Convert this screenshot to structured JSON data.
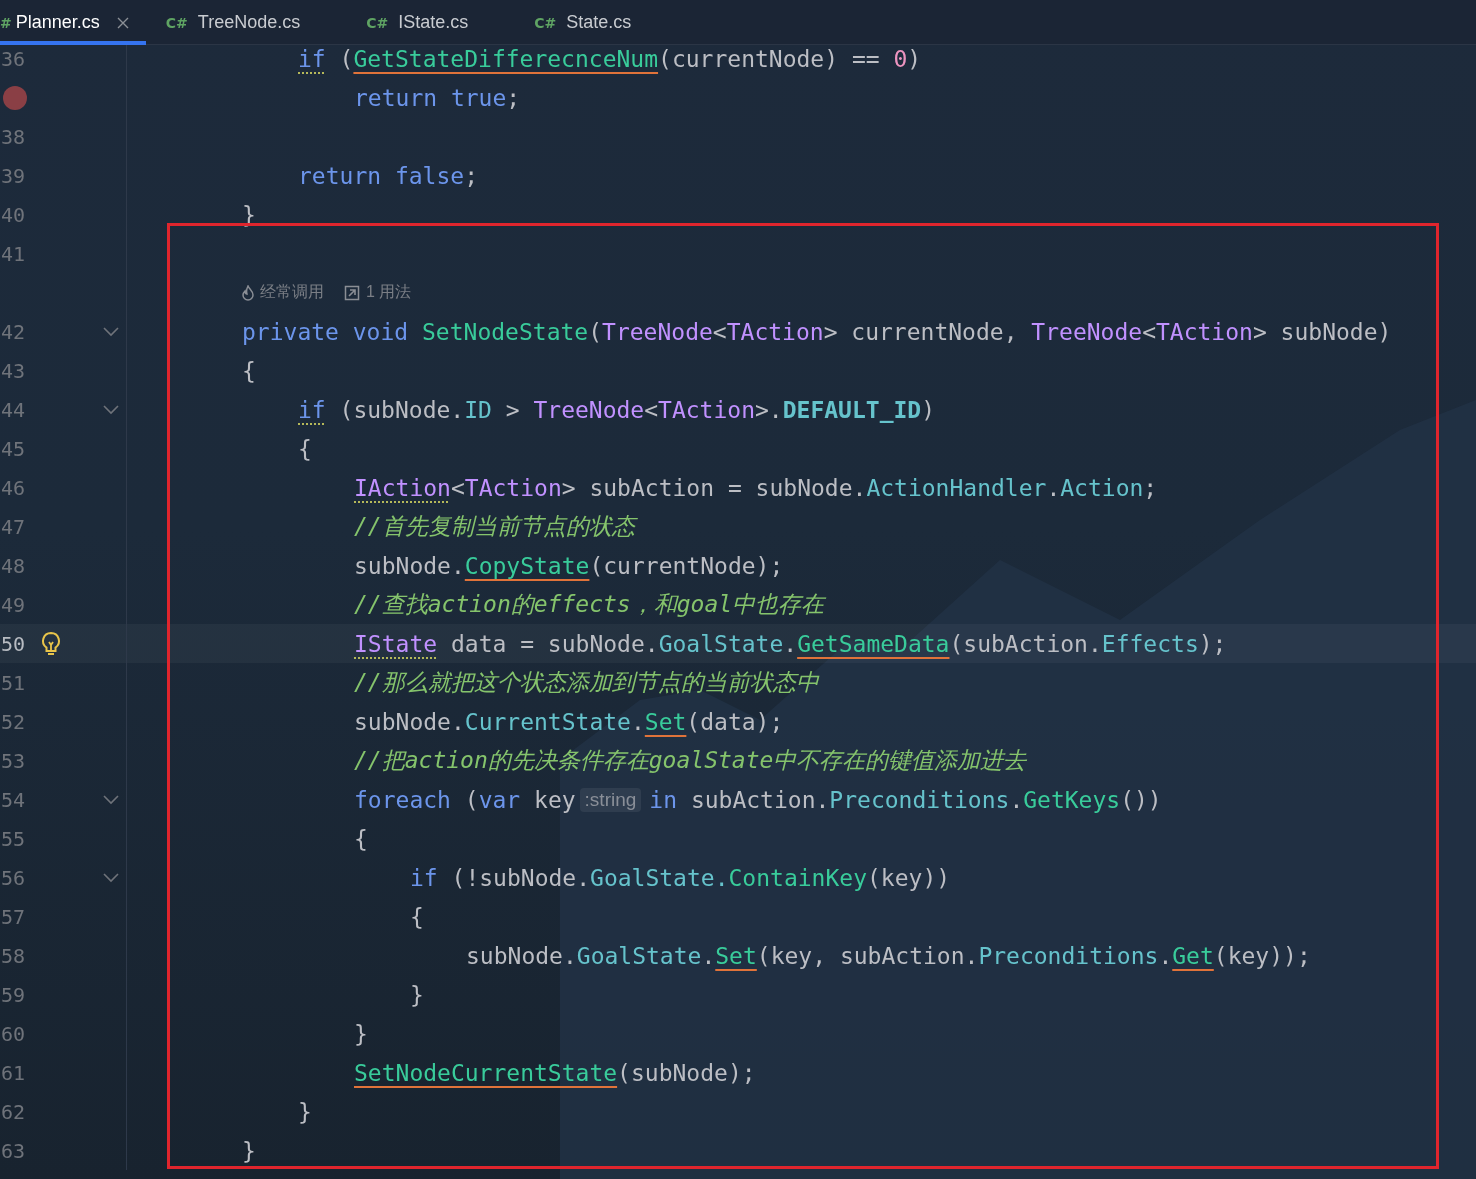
{
  "tabs": [
    {
      "icon": "#",
      "label": "Planner.cs",
      "selected": true
    },
    {
      "icon": "C#",
      "label": "TreeNode.cs",
      "selected": false
    },
    {
      "icon": "C#",
      "label": "IState.cs",
      "selected": false
    },
    {
      "icon": "C#",
      "label": "State.cs",
      "selected": false
    }
  ],
  "lines": [
    {
      "kind": "block",
      "children": [
        {
          "kind": "code",
          "number": "36",
          "tokens": [
            {
              "text": "if",
              "kind": "keyword",
              "warning": true
            },
            {
              "text": " (",
              "kind": "plain"
            },
            {
              "text": "GetStateDifferecnceNum",
              "kind": "method",
              "error": true
            },
            {
              "text": "(currentNode) == ",
              "kind": "plain"
            },
            {
              "text": "0",
              "kind": "number"
            },
            {
              "text": ")",
              "kind": "plain"
            }
          ],
          "children": [
            {
              "kind": "code",
              "breakpoint": true,
              "tokens": [
                {
                  "text": "return true",
                  "kind": "keyword"
                },
                {
                  "text": ";",
                  "kind": "plain"
                }
              ]
            }
          ]
        },
        {
          "kind": "code",
          "number": "38"
        },
        {
          "kind": "code",
          "number": "39",
          "tokens": [
            {
              "text": "return false",
              "kind": "keyword"
            },
            {
              "text": ";",
              "kind": "plain"
            }
          ]
        }
      ]
    },
    {
      "kind": "code",
      "number": "40",
      "tokens": [
        {
          "text": "}",
          "kind": "plain"
        }
      ]
    },
    {
      "kind": "code",
      "number": "41"
    },
    {
      "kind": "hint",
      "usage": "经常调用",
      "refs": "1 用法"
    },
    {
      "kind": "code",
      "number": "42",
      "fold": true,
      "tokens": [
        {
          "text": "private void ",
          "kind": "keyword"
        },
        {
          "text": "SetNodeState",
          "kind": "method"
        },
        {
          "text": "(",
          "kind": "plain"
        },
        {
          "text": "TreeNode",
          "kind": "type"
        },
        {
          "text": "<",
          "kind": "plain"
        },
        {
          "text": "TAction",
          "kind": "type"
        },
        {
          "text": "> currentNode, ",
          "kind": "plain"
        },
        {
          "text": "TreeNode",
          "kind": "type"
        },
        {
          "text": "<",
          "kind": "plain"
        },
        {
          "text": "TAction",
          "kind": "type"
        },
        {
          "text": "> subNode)",
          "kind": "plain"
        }
      ]
    },
    {
      "kind": "code",
      "number": "43",
      "tokens": [
        {
          "text": "{",
          "kind": "plain"
        }
      ],
      "children": [
        {
          "kind": "code",
          "number": "44",
          "fold": true,
          "tokens": [
            {
              "text": "if",
              "kind": "keyword",
              "warning": true
            },
            {
              "text": " (subNode.",
              "kind": "plain"
            },
            {
              "text": "ID",
              "kind": "property"
            },
            {
              "text": " > ",
              "kind": "plain"
            },
            {
              "text": "TreeNode",
              "kind": "type"
            },
            {
              "text": "<",
              "kind": "plain"
            },
            {
              "text": "TAction",
              "kind": "type"
            },
            {
              "text": ">.",
              "kind": "plain"
            },
            {
              "text": "DEFAULT_ID",
              "kind": "constant"
            },
            {
              "text": ")",
              "kind": "plain"
            }
          ]
        },
        {
          "kind": "code",
          "number": "45",
          "tokens": [
            {
              "text": "{",
              "kind": "plain"
            }
          ],
          "children": [
            {
              "kind": "code",
              "number": "46",
              "tokens": [
                {
                  "text": "IAction",
                  "kind": "type",
                  "warning": true
                },
                {
                  "text": "<",
                  "kind": "plain"
                },
                {
                  "text": "TAction",
                  "kind": "type"
                },
                {
                  "text": "> subAction = subNode.",
                  "kind": "plain"
                },
                {
                  "text": "ActionHandler",
                  "kind": "property"
                },
                {
                  "text": ".",
                  "kind": "plain"
                },
                {
                  "text": "Action",
                  "kind": "property"
                },
                {
                  "text": ";",
                  "kind": "plain"
                }
              ]
            },
            {
              "kind": "code",
              "number": "47",
              "tokens": [
                {
                  "text": "//首先复制当前节点的状态",
                  "kind": "comment"
                }
              ]
            },
            {
              "kind": "code",
              "number": "48",
              "tokens": [
                {
                  "text": "subNode.",
                  "kind": "plain"
                },
                {
                  "text": "CopyState",
                  "kind": "method",
                  "error": true
                },
                {
                  "text": "(currentNode);",
                  "kind": "plain"
                }
              ]
            },
            {
              "kind": "code",
              "number": "49",
              "tokens": [
                {
                  "text": "//查找action的effects，和goal中也存在",
                  "kind": "comment"
                }
              ]
            },
            {
              "kind": "code",
              "number": "50",
              "current": true,
              "bulb": true,
              "tokens": [
                {
                  "text": "IState",
                  "kind": "type",
                  "warning": true
                },
                {
                  "text": " data = subNode.",
                  "kind": "plain"
                },
                {
                  "text": "GoalState",
                  "kind": "property"
                },
                {
                  "text": ".",
                  "kind": "plain"
                },
                {
                  "text": "GetSameData",
                  "kind": "method",
                  "error": true
                },
                {
                  "text": "(subAction.",
                  "kind": "plain"
                },
                {
                  "text": "Effects",
                  "kind": "property"
                },
                {
                  "text": ");",
                  "kind": "plain"
                }
              ]
            },
            {
              "kind": "code",
              "number": "51",
              "tokens": [
                {
                  "text": "//那么就把这个状态添加到节点的当前状态中",
                  "kind": "comment"
                }
              ]
            },
            {
              "kind": "code",
              "number": "52",
              "tokens": [
                {
                  "text": "subNode.",
                  "kind": "plain"
                },
                {
                  "text": "CurrentState",
                  "kind": "property"
                },
                {
                  "text": ".",
                  "kind": "plain"
                },
                {
                  "text": "Set",
                  "kind": "method",
                  "error": true
                },
                {
                  "text": "(data);",
                  "kind": "plain"
                }
              ]
            },
            {
              "kind": "code",
              "number": "53",
              "tokens": [
                {
                  "text": "//把action的先决条件存在goalState中不存在的键值添加进去",
                  "kind": "comment"
                }
              ]
            },
            {
              "kind": "code",
              "number": "54",
              "fold": true,
              "tokens": [
                {
                  "text": "foreach",
                  "kind": "keyword"
                },
                {
                  "text": " (",
                  "kind": "plain"
                },
                {
                  "text": "var",
                  "kind": "keyword"
                },
                {
                  "text": " key",
                  "kind": "plain"
                },
                {
                  "text": ":string",
                  "kind": "inlay"
                },
                {
                  "text": "in",
                  "kind": "keyword"
                },
                {
                  "text": " subAction.",
                  "kind": "plain"
                },
                {
                  "text": "Preconditions",
                  "kind": "property"
                },
                {
                  "text": ".",
                  "kind": "plain"
                },
                {
                  "text": "GetKeys",
                  "kind": "method"
                },
                {
                  "text": "())",
                  "kind": "plain"
                }
              ]
            },
            {
              "kind": "code",
              "number": "55",
              "tokens": [
                {
                  "text": "{",
                  "kind": "plain"
                }
              ],
              "children": [
                {
                  "kind": "code",
                  "number": "56",
                  "fold": true,
                  "tokens": [
                    {
                      "text": "if",
                      "kind": "keyword"
                    },
                    {
                      "text": " (!subNode.",
                      "kind": "plain"
                    },
                    {
                      "text": "GoalState.",
                      "kind": "property"
                    },
                    {
                      "text": "ContainKey",
                      "kind": "method"
                    },
                    {
                      "text": "(key))",
                      "kind": "plain"
                    }
                  ]
                },
                {
                  "kind": "code",
                  "number": "57",
                  "tokens": [
                    {
                      "text": "{",
                      "kind": "plain"
                    }
                  ],
                  "children": [
                    {
                      "kind": "code",
                      "number": "58",
                      "tokens": [
                        {
                          "text": "subNode.",
                          "kind": "plain"
                        },
                        {
                          "text": "GoalState",
                          "kind": "property"
                        },
                        {
                          "text": ".",
                          "kind": "plain"
                        },
                        {
                          "text": "Set",
                          "kind": "method",
                          "error": true
                        },
                        {
                          "text": "(key, subAction.",
                          "kind": "plain"
                        },
                        {
                          "text": "Preconditions",
                          "kind": "property"
                        },
                        {
                          "text": ".",
                          "kind": "plain"
                        },
                        {
                          "text": "Get",
                          "kind": "method",
                          "error": true
                        },
                        {
                          "text": "(key));",
                          "kind": "plain"
                        }
                      ]
                    }
                  ]
                },
                {
                  "kind": "code",
                  "number": "59",
                  "tokens": [
                    {
                      "text": "}",
                      "kind": "plain"
                    }
                  ]
                }
              ]
            },
            {
              "kind": "code",
              "number": "60",
              "tokens": [
                {
                  "text": "}",
                  "kind": "plain"
                }
              ]
            },
            {
              "kind": "code",
              "number": "61",
              "tokens": [
                {
                  "text": "SetNodeCurrentState",
                  "kind": "method",
                  "error": true
                },
                {
                  "text": "(subNode);",
                  "kind": "plain"
                }
              ]
            }
          ]
        },
        {
          "kind": "code",
          "number": "62",
          "tokens": [
            {
              "text": "}",
              "kind": "plain"
            }
          ]
        }
      ]
    },
    {
      "kind": "code",
      "number": "63",
      "tokens": [
        {
          "text": "}",
          "kind": "plain"
        }
      ]
    }
  ],
  "annotation": {
    "kind": "rectangle"
  }
}
